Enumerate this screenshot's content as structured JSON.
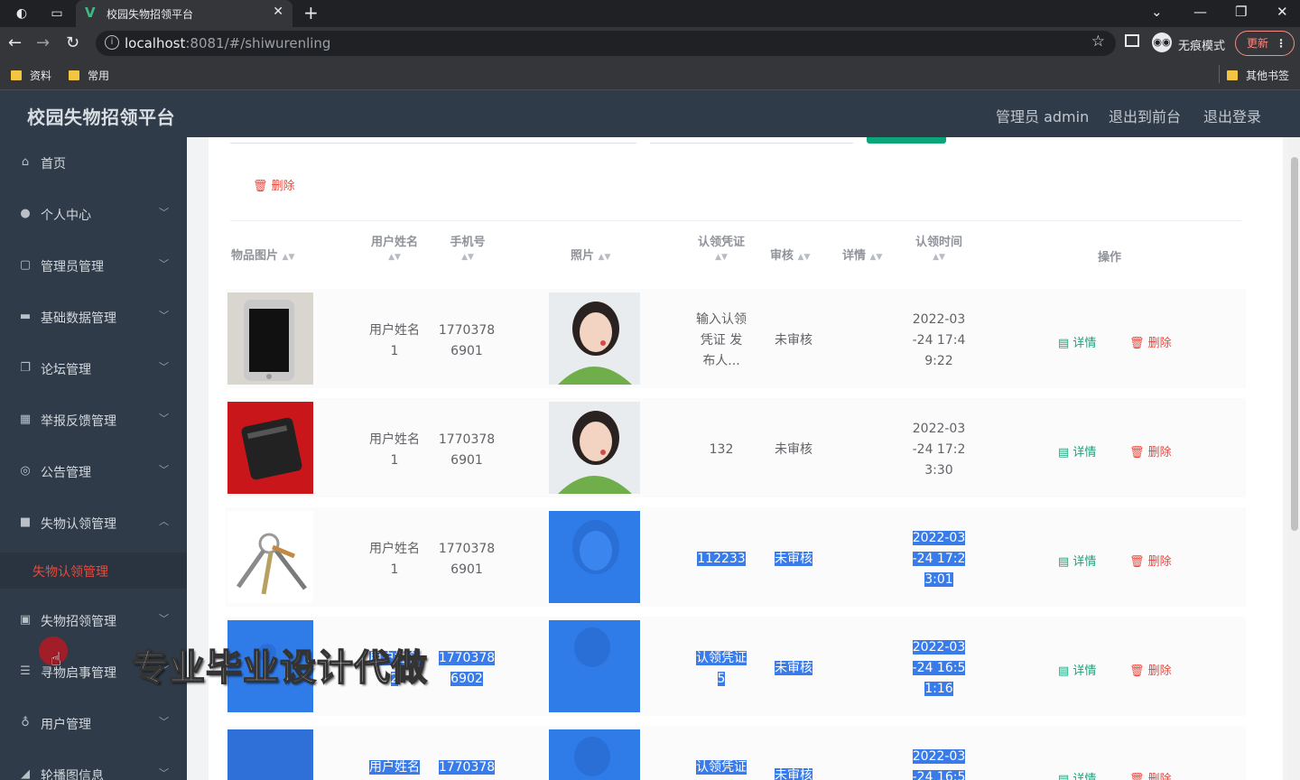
{
  "browser": {
    "tab_title": "校园失物招领平台",
    "url_host": "localhost",
    "url_rest": ":8081/#/shiwurenling",
    "incognito_label": "无痕模式",
    "update_label": "更新",
    "bookmarks": [
      "资料",
      "常用"
    ],
    "other_bookmarks": "其他书签"
  },
  "header": {
    "title": "校园失物招领平台",
    "admin": "管理员 admin",
    "front": "退出到前台",
    "logout": "退出登录"
  },
  "sidebar": {
    "items": [
      "首页",
      "个人中心",
      "管理员管理",
      "基础数据管理",
      "论坛管理",
      "举报反馈管理",
      "公告管理",
      "失物认领管理",
      "失物招领管理",
      "寻物启事管理",
      "用户管理",
      "轮播图信息"
    ],
    "active_sub": "失物认领管理"
  },
  "toolbar": {
    "delete": "删除"
  },
  "table": {
    "headers": {
      "item_img": "物品图片",
      "user_name": "用户姓名",
      "phone": "手机号",
      "photo": "照片",
      "voucher": "认领凭证",
      "review": "审核",
      "detail": "详情",
      "claim_time": "认领时间",
      "ops": "操作"
    },
    "rows": [
      {
        "name": [
          "用户姓名",
          "1"
        ],
        "phone": [
          "1770378",
          "6901"
        ],
        "voucher": [
          "输入认领",
          "凭证 发",
          "布人..."
        ],
        "review": "未审核",
        "time": [
          "2022-03",
          "-24 17:4",
          "9:22"
        ]
      },
      {
        "name": [
          "用户姓名",
          "1"
        ],
        "phone": [
          "1770378",
          "6901"
        ],
        "voucher": [
          "132"
        ],
        "review": "未审核",
        "time": [
          "2022-03",
          "-24 17:2",
          "3:30"
        ]
      },
      {
        "name": [
          "用户姓名",
          "1"
        ],
        "phone": [
          "1770378",
          "6901"
        ],
        "voucher": [
          "112233"
        ],
        "review": "未审核",
        "time": [
          "2022-03",
          "-24 17:2",
          "3:01"
        ]
      },
      {
        "name": [
          "用户姓名",
          "2"
        ],
        "phone": [
          "1770378",
          "6902"
        ],
        "voucher": [
          "认领凭证",
          "5"
        ],
        "review": "未审核",
        "time": [
          "2022-03",
          "-24 16:5",
          "1:16"
        ]
      },
      {
        "name": [
          "用户姓名"
        ],
        "phone": [
          "1770378"
        ],
        "voucher": [
          "认领凭证"
        ],
        "review": "未审核",
        "time": [
          "2022-03",
          "-24 16:5"
        ]
      }
    ],
    "action_detail": "详情",
    "action_delete": "删除"
  },
  "watermark": "专业毕业设计代做",
  "colors": {
    "sidebar_bg": "#2f3b48",
    "accent_red": "#e8463a",
    "accent_green": "#16a47a",
    "selection": "#3a7bea"
  }
}
